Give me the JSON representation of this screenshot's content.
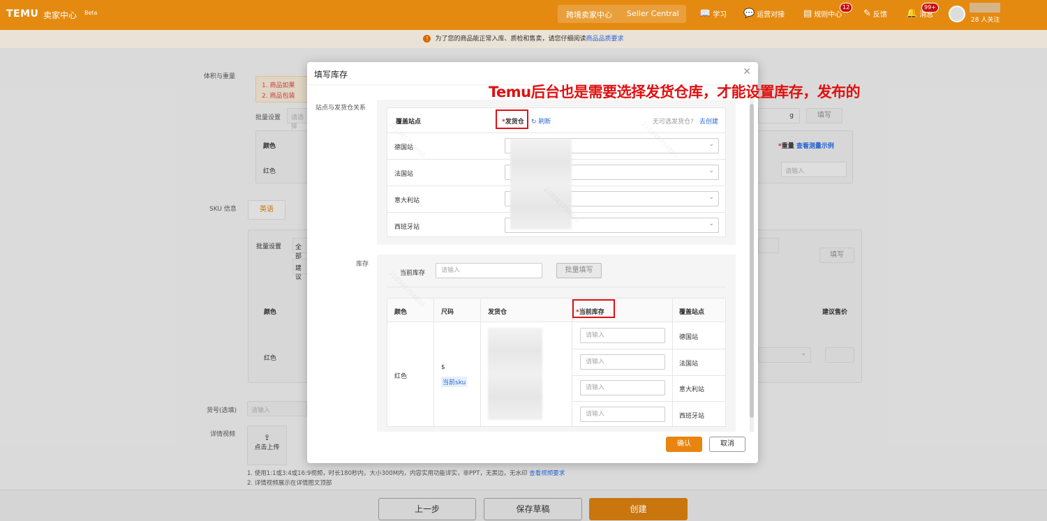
{
  "topbar": {
    "logo": "TEMU",
    "brand": "卖家中心",
    "beta": "Beta",
    "pill_left": "跨境卖家中心",
    "pill_right": "Seller Central",
    "nav": [
      {
        "icon": "book-icon",
        "label": "学习"
      },
      {
        "icon": "chat-icon",
        "label": "运营对接"
      },
      {
        "icon": "document-icon",
        "label": "规则中心",
        "badge": "12"
      },
      {
        "icon": "feedback-icon",
        "label": "反馈"
      },
      {
        "icon": "bell-icon",
        "label": "消息",
        "badge": "99+"
      }
    ],
    "follow": "28 人关注"
  },
  "notice": {
    "text": "为了您的商品能正常入库、质检和售卖，请您仔细阅读",
    "link": "商品品质要求"
  },
  "underlay": {
    "volume_label": "体积与重量",
    "tip1": "1. 商品如果",
    "tip2": "2. 商品包装",
    "batch_label": "批量设置",
    "batch_placeholder": "请选择",
    "unit_g": "g",
    "fill_button": "填写",
    "color_header": "颜色",
    "weight_header": "重量",
    "weight_link": "查看测量示例",
    "red": "红色",
    "weight_placeholder": "请输入",
    "sku_label": "SKU 信息",
    "lang_tab": "英语",
    "batch2_label": "批量设置",
    "all_select": "全部",
    "suggest_btn": "建议",
    "fill2_button": "填写",
    "color2_header": "颜色",
    "price_header": "建议售价",
    "red2": "红色",
    "goods_no_label": "货号(选填)",
    "goods_no_placeholder": "请输入",
    "video_label": "详情视频",
    "upload_label": "点击上传",
    "video_tip1": "1. 使用1:1或3:4或16:9视频，时长180秒内，大小300M内，内容实用功能详实，非PPT，无黑边，无水印",
    "video_tip_link": "查看视频要求",
    "video_tip2": "2. 详情视频展示在详情图文顶部"
  },
  "footer": {
    "prev": "上一步",
    "draft": "保存草稿",
    "create": "创建"
  },
  "modal": {
    "title": "填写库存",
    "section1_label": "站点与发货仓关系",
    "col_site": "覆盖站点",
    "col_warehouse": "发货仓",
    "refresh": "刷新",
    "no_warehouse": "无可选发货仓?",
    "go_create": "去创建",
    "sites": [
      "德国站",
      "法国站",
      "意大利站",
      "西班牙站"
    ],
    "section2_label": "库存",
    "current_stock_label": "当前库存",
    "current_stock_placeholder": "请输入",
    "batch_fill": "批量填写",
    "t2_headers": {
      "color": "颜色",
      "size": "尺码",
      "warehouse": "发货仓",
      "stock": "当前库存",
      "site": "覆盖站点"
    },
    "t2_color": "红色",
    "t2_size_symbol": "$",
    "t2_size_tag": "当前sku",
    "stock_placeholder": "请输入",
    "confirm": "确认",
    "cancel": "取消"
  },
  "annotation": "Temu后台也是需要选择发货仓库，才能设置库存，发布的",
  "watermark": "210345754850"
}
